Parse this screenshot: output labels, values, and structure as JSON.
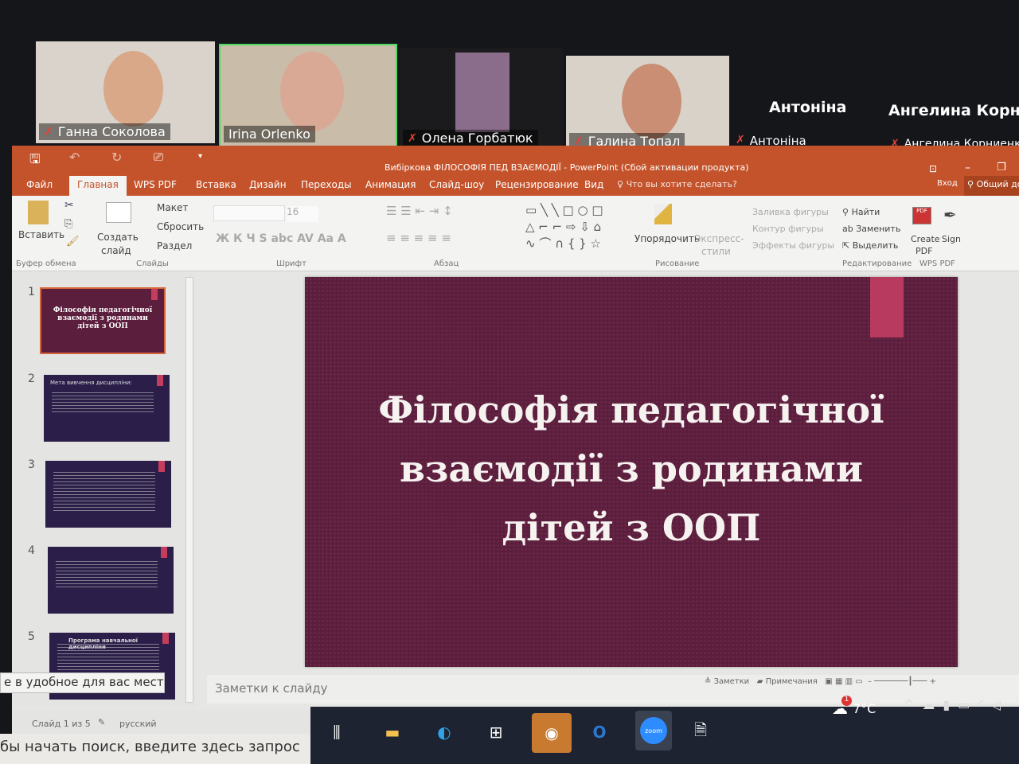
{
  "zoom": {
    "participants": [
      {
        "name": "Ганна Соколова",
        "muted": true
      },
      {
        "name": "Irina Orlenko",
        "muted": false,
        "active_speaker": true
      },
      {
        "name": "Олена Горбатюк",
        "muted": true
      },
      {
        "name": "Галина Топал",
        "muted": true
      },
      {
        "name": "Антоніна",
        "display": "Антоніна",
        "muted": true
      },
      {
        "name": "Ангелина Корниенко",
        "display": "Ангелина Корн...",
        "muted": true
      }
    ],
    "active_color": "#4cd964"
  },
  "ppt": {
    "title": "Вибіркова ФІЛОСОФІЯ ПЕД ВЗАЄМОДІЇ - PowerPoint (Сбой активации продукта)",
    "tabs": [
      "Файл",
      "Главная",
      "WPS PDF",
      "Вставка",
      "Дизайн",
      "Переходы",
      "Анимация",
      "Слайд-шоу",
      "Рецензирование",
      "Вид"
    ],
    "tell_me": "Что вы хотите сделать?",
    "signin": "Вход",
    "share": "Общий до",
    "ribbon": {
      "paste": "Вставить",
      "clipboard": "Буфер обмена",
      "new_slide_1": "Создать",
      "new_slide_2": "слайд",
      "layout": "Макет",
      "reset": "Сбросить",
      "section": "Раздел",
      "slides": "Слайды",
      "font_size": "16",
      "font": "Шрифт",
      "font_buttons": "Ж К Ч S abc AV Aa A",
      "paragraph": "Абзац",
      "arrange": "Упорядочить",
      "quick_styles_1": "Экспресс-",
      "quick_styles_2": "стили",
      "shape_fill": "Заливка фигуры",
      "shape_outline": "Контур фигуры",
      "shape_effects": "Эффекты фигуры",
      "drawing": "Рисование",
      "find": "Найти",
      "replace": "Заменить",
      "select": "Выделить",
      "editing": "Редактирование",
      "create_pdf_1": "Create",
      "create_pdf_2": "PDF",
      "sign": "Sign",
      "wps_pdf": "WPS PDF"
    },
    "thumbnails": [
      {
        "n": "1",
        "title": "Філософія педагогічної взаємодії з родинами дітей з ООП"
      },
      {
        "n": "2",
        "title": "Мета вивчення дисципліни:"
      },
      {
        "n": "3",
        "title": ""
      },
      {
        "n": "4",
        "title": ""
      },
      {
        "n": "5",
        "title": "Програма навчальної дисципліни"
      }
    ],
    "slide_title": "Філософія педагогічної взаємодії з родинами дітей з ООП",
    "slide_color": "#5b1e3c",
    "notes_placeholder": "Заметки к слайду",
    "status": {
      "slide": "Слайд 1 из 5",
      "language": "русский",
      "notes": "Заметки",
      "comments": "Примечания"
    }
  },
  "tooltip": "е в удобное для вас место",
  "taskbar": {
    "search": "бы начать поиск, введите здесь запрос",
    "weather": "7°C",
    "weather_badge": "1",
    "zoom": "zoom"
  }
}
